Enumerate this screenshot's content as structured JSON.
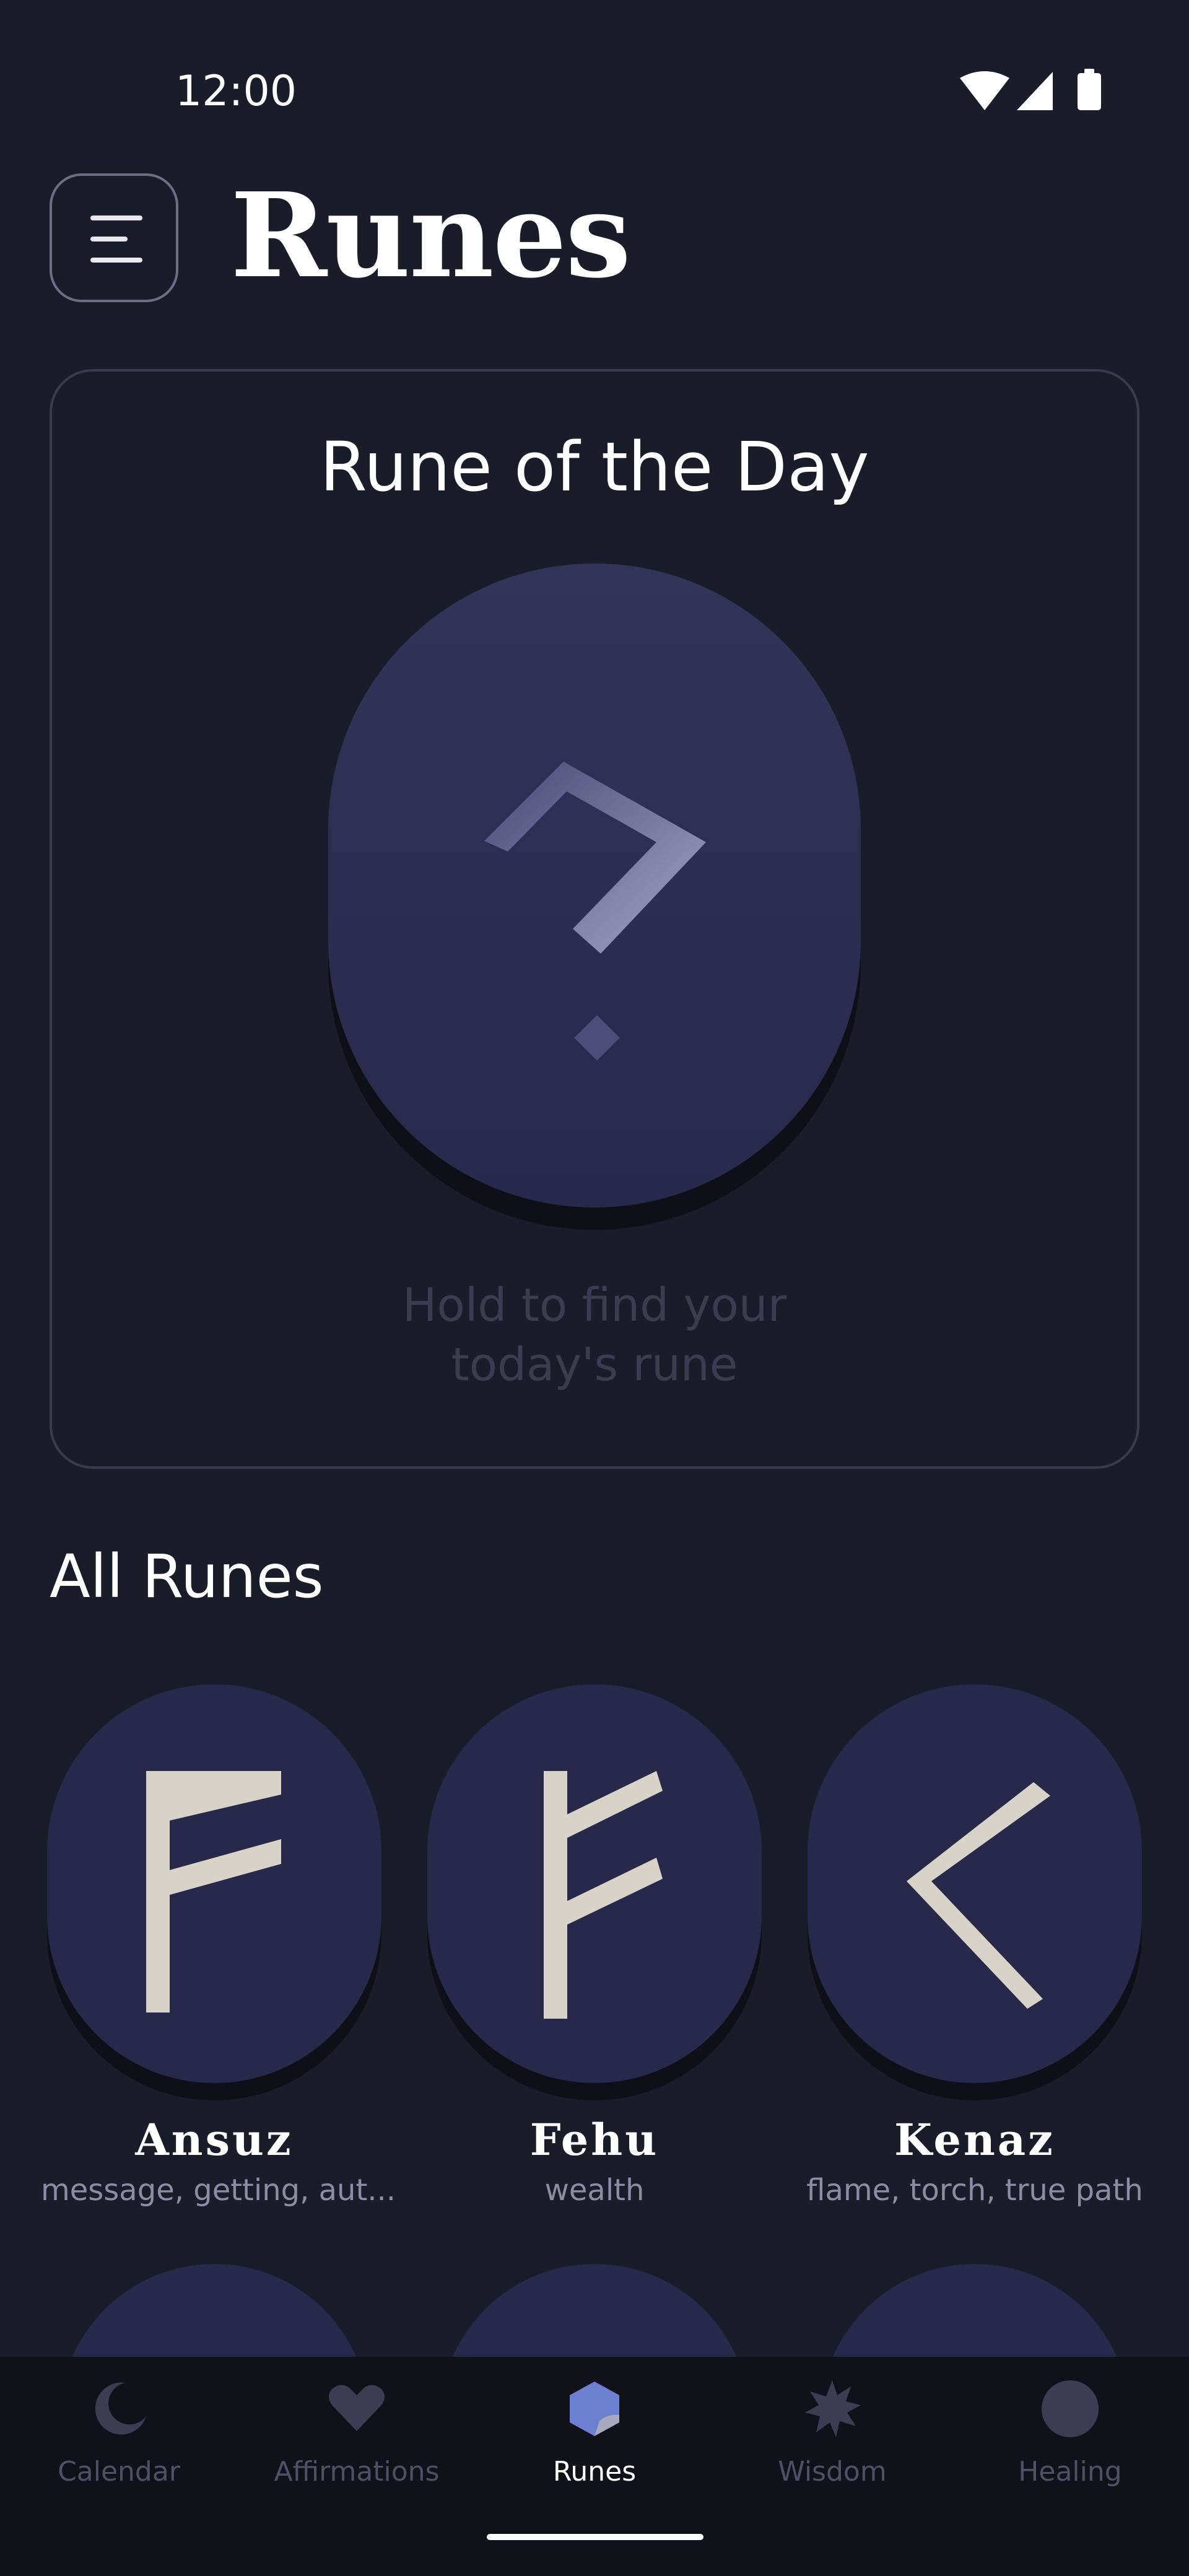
{
  "status_bar": {
    "time": "12:00"
  },
  "header": {
    "title": "Runes"
  },
  "rune_of_the_day": {
    "title": "Rune of the Day",
    "hint_line1": "Hold to find your",
    "hint_line2": "today's rune"
  },
  "all_runes": {
    "title": "All Runes",
    "items": [
      {
        "name": "Ansuz",
        "description": "message, getting, aut..."
      },
      {
        "name": "Fehu",
        "description": "wealth"
      },
      {
        "name": "Kenaz",
        "description": "flame, torch, true path"
      }
    ]
  },
  "bottom_nav": {
    "items": [
      {
        "label": "Calendar",
        "icon": "moon-icon"
      },
      {
        "label": "Affirmations",
        "icon": "heart-icon"
      },
      {
        "label": "Runes",
        "icon": "rune-stone-icon",
        "active": true
      },
      {
        "label": "Wisdom",
        "icon": "star-icon"
      },
      {
        "label": "Healing",
        "icon": "circle-icon"
      }
    ]
  },
  "colors": {
    "background": "#1b1c29",
    "stone": "#2a2a45",
    "accent": "#6d7fd1",
    "nav_background": "#111119"
  }
}
